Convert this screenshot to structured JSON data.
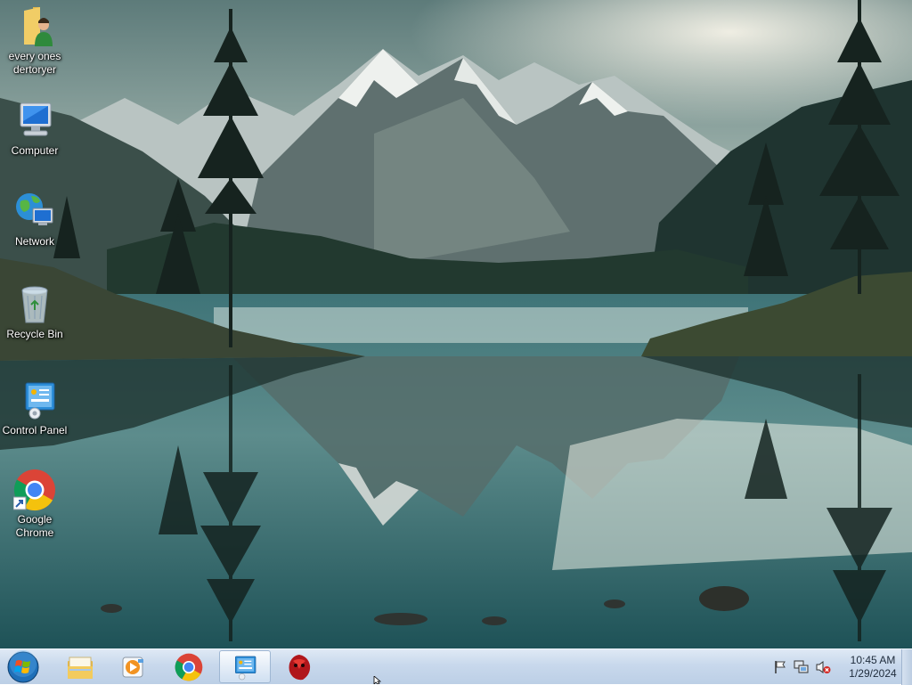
{
  "desktop": {
    "icons": [
      {
        "label": "every ones dertoryer",
        "icon": "user-folder-icon"
      },
      {
        "label": "Computer",
        "icon": "computer-icon"
      },
      {
        "label": "Network",
        "icon": "network-icon"
      },
      {
        "label": "Recycle Bin",
        "icon": "recycle-bin-icon"
      },
      {
        "label": "Control Panel",
        "icon": "control-panel-icon"
      },
      {
        "label": "Google Chrome",
        "icon": "chrome-icon",
        "shortcut": true
      }
    ]
  },
  "taskbar": {
    "start": {
      "icon": "windows-start-icon"
    },
    "pinned": [
      {
        "name": "Windows Explorer",
        "icon": "explorer-folder-icon"
      },
      {
        "name": "Windows Media Player",
        "icon": "media-player-icon"
      },
      {
        "name": "Google Chrome",
        "icon": "chrome-icon"
      },
      {
        "name": "Control Panel",
        "icon": "control-panel-icon",
        "active": true
      },
      {
        "name": "Red App",
        "icon": "red-creature-icon"
      }
    ],
    "tray": {
      "icons": [
        "action-center-flag-icon",
        "network-status-icon",
        "volume-muted-icon"
      ],
      "time": "10:45 AM",
      "date": "1/29/2024"
    }
  },
  "colors": {
    "taskbar_top": "#dfe9f5",
    "taskbar_bottom": "#bccfe6",
    "chrome_red": "#db4437",
    "chrome_yellow": "#f4c20d",
    "chrome_green": "#0f9d58",
    "chrome_blue": "#4285f4"
  }
}
